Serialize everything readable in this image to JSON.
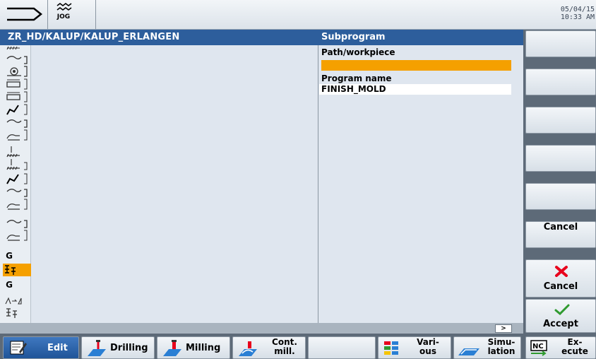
{
  "header": {
    "mode_icon": "program-pointer-icon",
    "operating_mode": "JOG",
    "date": "05/04/15",
    "time": "10:33 AM"
  },
  "titlebar": {
    "path": "ZR_HD/KALUP/KALUP_ERLANGEN",
    "dialog_title": "Subprogram"
  },
  "form": {
    "path_label": "Path/workpiece",
    "path_value": "",
    "program_name_label": "Program name",
    "program_name_value": "FINISH_MOLD"
  },
  "editor": {
    "scroll_arrow": ">"
  },
  "left_strip": {
    "g1": "G",
    "g2": "G"
  },
  "vertical_softkeys": [
    {
      "label": ""
    },
    {
      "label": ""
    },
    {
      "label": ""
    },
    {
      "label": ""
    },
    {
      "label": ""
    },
    {
      "label": "Cancel",
      "icon": "cross-icon"
    },
    {
      "label": "Accept",
      "icon": "checkmark-icon"
    }
  ],
  "horizontal_softkeys": [
    {
      "label": "Edit",
      "icon": "edit-icon",
      "active": true
    },
    {
      "label": "Drilling",
      "icon": "drilling-icon"
    },
    {
      "label": "Milling",
      "icon": "milling-icon"
    },
    {
      "label_line1": "Cont.",
      "label_line2": "mill.",
      "icon": "contour-milling-icon"
    },
    {
      "label": ""
    },
    {
      "label_line1": "Vari-",
      "label_line2": "ous",
      "icon": "various-icon"
    },
    {
      "label_line1": "Simu-",
      "label_line2": "lation",
      "icon": "simulation-icon"
    },
    {
      "label_line1": "Ex-",
      "label_line2": "ecute",
      "icon": "nc-execute-icon"
    }
  ],
  "colors": {
    "titlebar": "#2d5e9c",
    "highlight_field": "#f5a000",
    "cancel_icon": "#e8001c",
    "accept_icon": "#2f9a2f"
  }
}
